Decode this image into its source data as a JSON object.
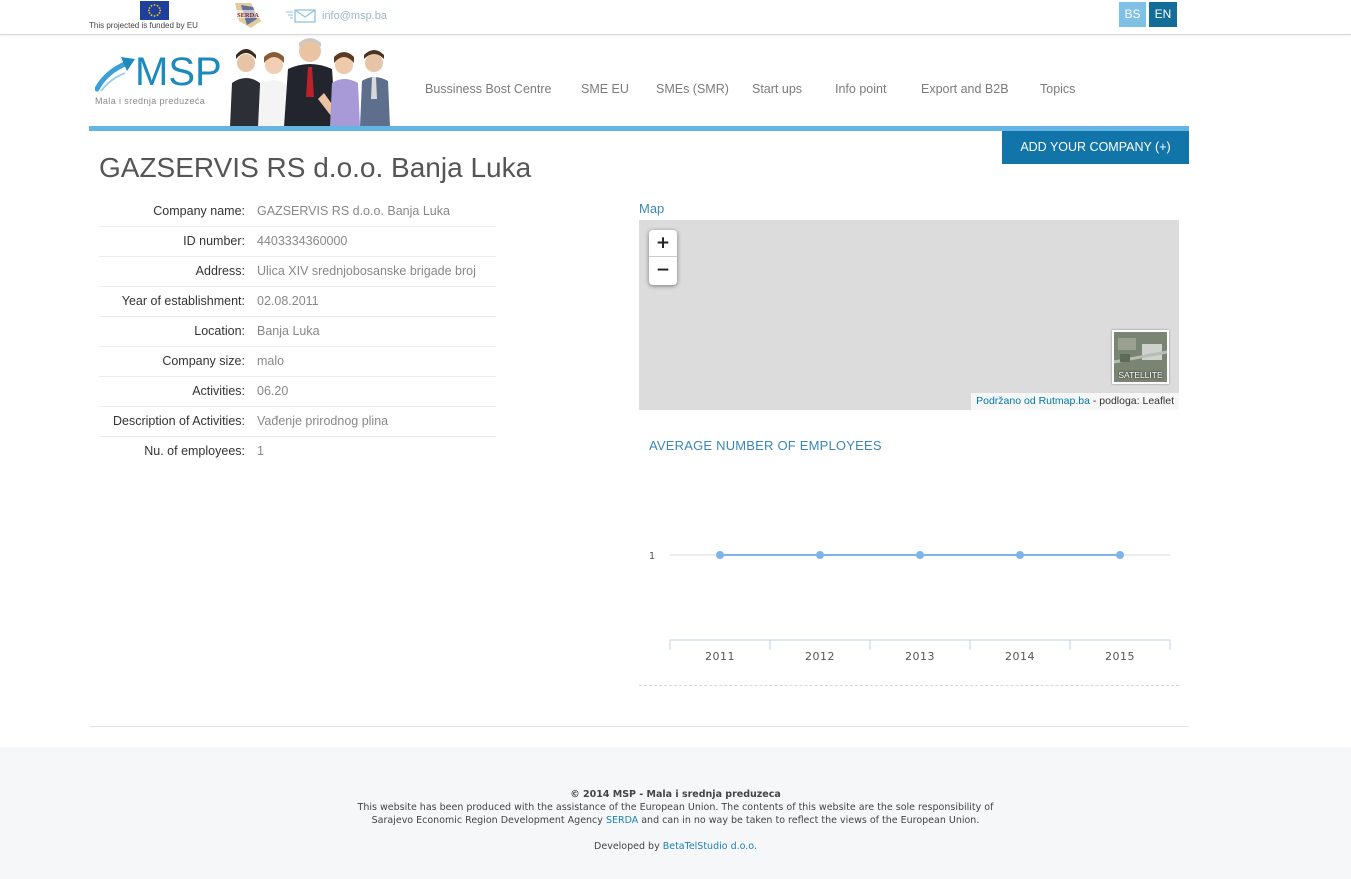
{
  "topbar": {
    "eu_caption": "This projected is funded by EU",
    "email": "info@msp.ba",
    "lang_bs": "BS",
    "lang_en": "EN"
  },
  "logo": {
    "name": "MSP",
    "subtitle": "Mala i srednja preduzeća"
  },
  "nav": {
    "items": [
      "Bussiness Bost Centre",
      "SME EU",
      "SMEs (SMR)",
      "Start ups",
      "Info point",
      "Export and B2B",
      "Topics"
    ]
  },
  "add_company_label": "ADD YOUR COMPANY (+)",
  "page_title": "GAZSERVIS RS d.o.o. Banja Luka",
  "details": [
    {
      "label": "Company name:",
      "value": "GAZSERVIS RS d.o.o. Banja Luka"
    },
    {
      "label": "ID number:",
      "value": "4403334360000"
    },
    {
      "label": "Address:",
      "value": "Ulica XIV srednjobosanske brigade broj"
    },
    {
      "label": "Year of establishment:",
      "value": "02.08.2011"
    },
    {
      "label": "Location:",
      "value": "Banja Luka"
    },
    {
      "label": "Company size:",
      "value": "malo"
    },
    {
      "label": "Activities:",
      "value": "06.20"
    },
    {
      "label": "Description of Activities:",
      "value": "Vađenje prirodnog plina"
    },
    {
      "label": "Nu. of employees:",
      "value": "1"
    }
  ],
  "map": {
    "heading": "Map",
    "zoom_in": "+",
    "zoom_out": "−",
    "satellite_label": "SATELLITE",
    "attribution_link": "Podržano od Rutmap.ba",
    "attribution_rest": " - podloga: Leaflet"
  },
  "chart_title": "AVERAGE NUMBER OF EMPLOYEES",
  "chart_data": {
    "type": "line",
    "title": "AVERAGE NUMBER OF EMPLOYEES",
    "categories": [
      "2011",
      "2012",
      "2013",
      "2014",
      "2015"
    ],
    "series": [
      {
        "values": [
          1,
          1,
          1,
          1,
          1
        ]
      }
    ],
    "y_ticks": [
      "1"
    ],
    "color": "#7cb5ec",
    "grid": true
  },
  "footer": {
    "title": "© 2014 MSP - Mala i srednja preduzeca",
    "line1": "This website has been produced with the assistance of the European Union. The contents of this website are the sole responsibility of",
    "line2_pre": "Sarajevo Economic Region Development Agency ",
    "line2_link": "SERDA",
    "line2_post": " and can in no way be taken to reflect the views of the European Union.",
    "dev_pre": "Developed by ",
    "dev_link": "BetaTelStudio d.o.o."
  }
}
